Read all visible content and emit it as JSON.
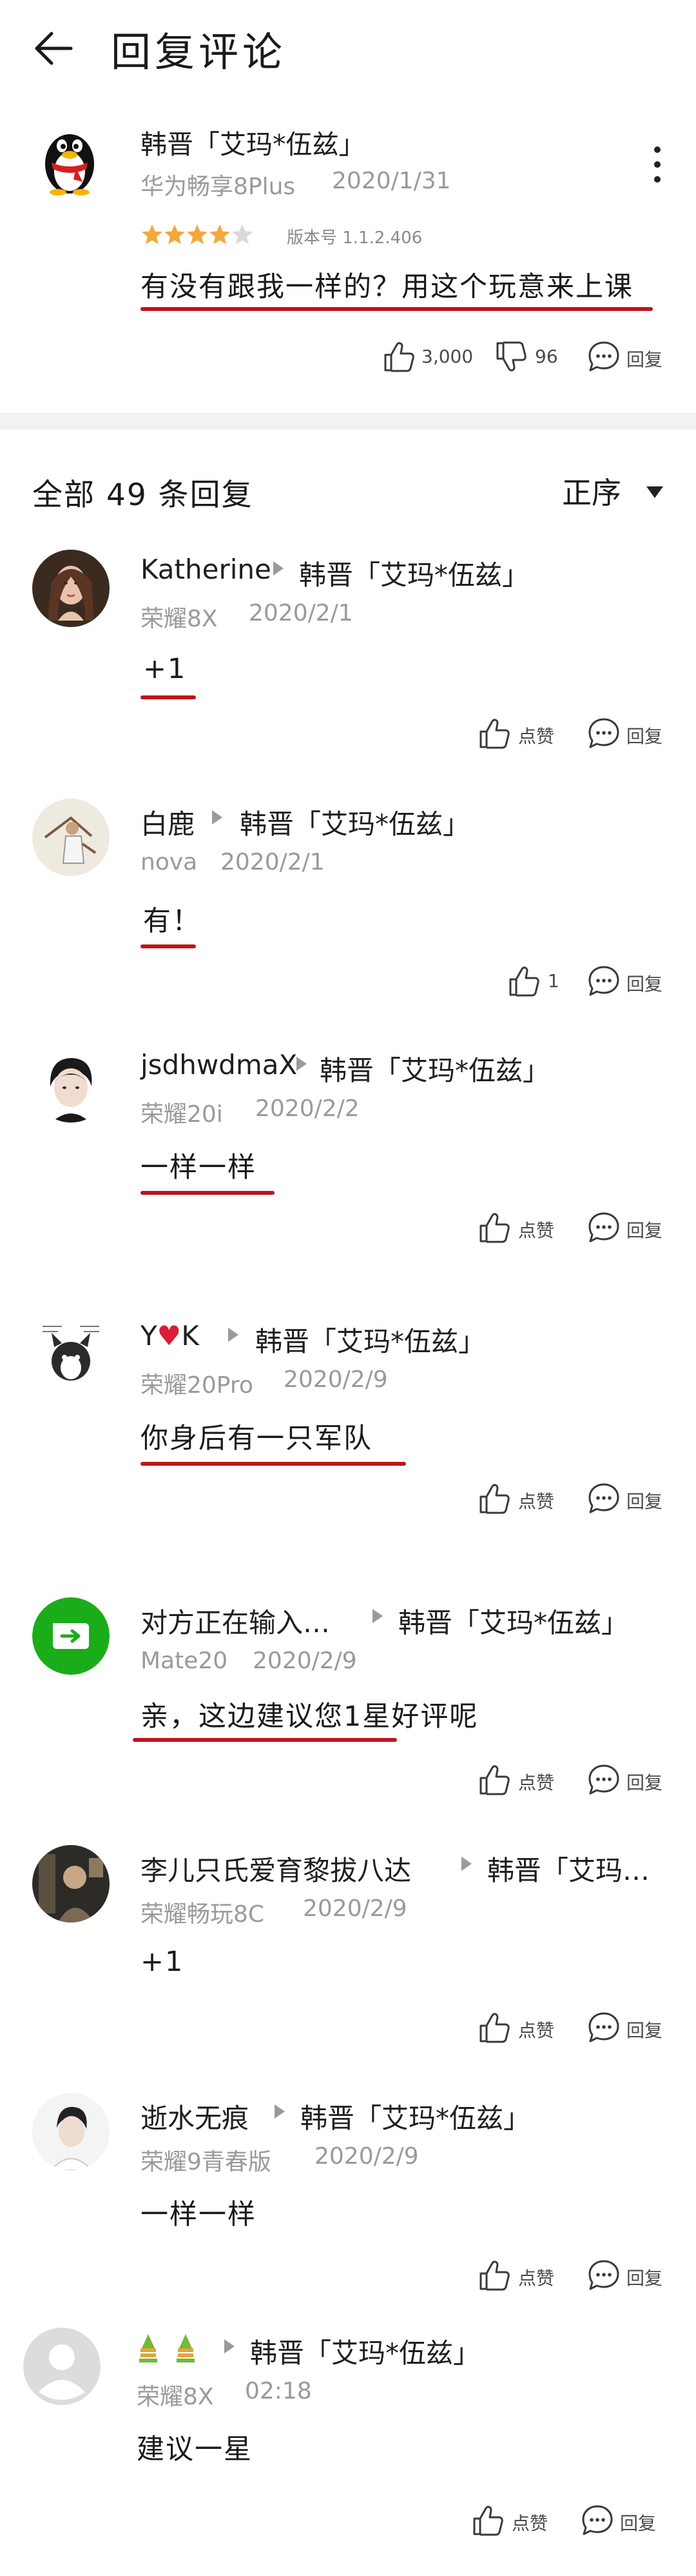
{
  "header": {
    "title": "回复评论"
  },
  "main_comment": {
    "author": "韩晋「艾玛*伍兹」",
    "device": "华为畅享8Plus",
    "date": "2020/1/31",
    "rating_stars": 4,
    "version": "版本号 1.1.2.406",
    "content": "有没有跟我一样的？用这个玩意来上课",
    "likes": "3,000",
    "dislikes": "96",
    "reply_label": "回复"
  },
  "replies_header": {
    "count_text": "全部 49 条回复",
    "sort_label": "正序"
  },
  "replies": [
    {
      "author": "Katherine",
      "target": "韩晋「艾玛*伍兹」",
      "device": "荣耀8X",
      "date": "2020/2/1",
      "content": "+1",
      "like_label": "点赞",
      "reply_label": "回复"
    },
    {
      "author": "白鹿",
      "target": "韩晋「艾玛*伍兹」",
      "device": "nova",
      "date": "2020/2/1",
      "content": "有！",
      "like_label": "1",
      "reply_label": "回复"
    },
    {
      "author": "jsdhwdmaX",
      "target": "韩晋「艾玛*伍兹」",
      "device": "荣耀20i",
      "date": "2020/2/2",
      "content": "一样一样",
      "like_label": "点赞",
      "reply_label": "回复"
    },
    {
      "author_prefix": "Y",
      "author_suffix": "K",
      "target": "韩晋「艾玛*伍兹」",
      "device": "荣耀20Pro",
      "date": "2020/2/9",
      "content": "你身后有一只军队",
      "like_label": "点赞",
      "reply_label": "回复"
    },
    {
      "author": "对方正在输入…",
      "target": "韩晋「艾玛*伍兹」",
      "device": "Mate20",
      "date": "2020/2/9",
      "content": "亲，这边建议您1星好评呢",
      "like_label": "点赞",
      "reply_label": "回复"
    },
    {
      "author": "李儿只氏爱育黎拔八达",
      "target": "韩晋「艾玛…",
      "device": "荣耀畅玩8C",
      "date": "2020/2/9",
      "content": "+1",
      "like_label": "点赞",
      "reply_label": "回复"
    },
    {
      "author": "逝水无痕",
      "target": "韩晋「艾玛*伍兹」",
      "device": "荣耀9青春版",
      "date": "2020/2/9",
      "content": "一样一样",
      "like_label": "点赞",
      "reply_label": "回复"
    },
    {
      "author": "",
      "target": "韩晋「艾玛*伍兹」",
      "device": "荣耀8X",
      "date": "02:18",
      "content": "建议一星",
      "like_label": "点赞",
      "reply_label": "回复"
    }
  ],
  "colors": {
    "accent_underline": "#c0131b",
    "star": "#f2a93b",
    "wechat_green": "#1aad19"
  }
}
